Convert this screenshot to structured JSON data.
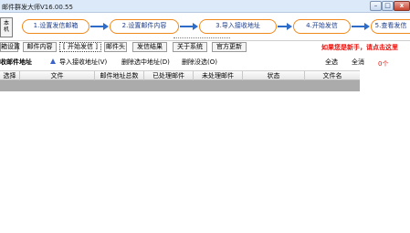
{
  "window": {
    "title": "邮件群发大师V16.00.55",
    "buttons": {
      "minimize": "–",
      "maximize": "□",
      "close": "x"
    }
  },
  "wizard": {
    "side_button": "本\n机",
    "steps": [
      {
        "label": "1.设置发信邮箱"
      },
      {
        "label": "2.设置邮件内容"
      },
      {
        "label": "3.导入接收地址"
      },
      {
        "label": "4.开始发信"
      },
      {
        "label": "5.查看发信"
      }
    ]
  },
  "tabs": [
    {
      "label": "箱设置"
    },
    {
      "label": "邮件内容"
    },
    {
      "label": "[ 开始发信 ]",
      "active": true
    },
    {
      "label": "邮件头"
    },
    {
      "label": "发信结果"
    },
    {
      "label": "关于系统"
    },
    {
      "label": "官方更新"
    }
  ],
  "notice": "如果您是新手，请点击这里",
  "toolbar": {
    "title": "收邮件地址",
    "import": "导入接收地址(V)",
    "delete_selected": "删除选中地址(D)",
    "delete_all": "删除没选(O)",
    "select_all": "全选",
    "clear": "全消",
    "count": "0个"
  },
  "table": {
    "columns": [
      "选择",
      "文件",
      "邮件地址总数",
      "已处理邮件",
      "未处理邮件",
      "状态",
      "文件名"
    ]
  }
}
